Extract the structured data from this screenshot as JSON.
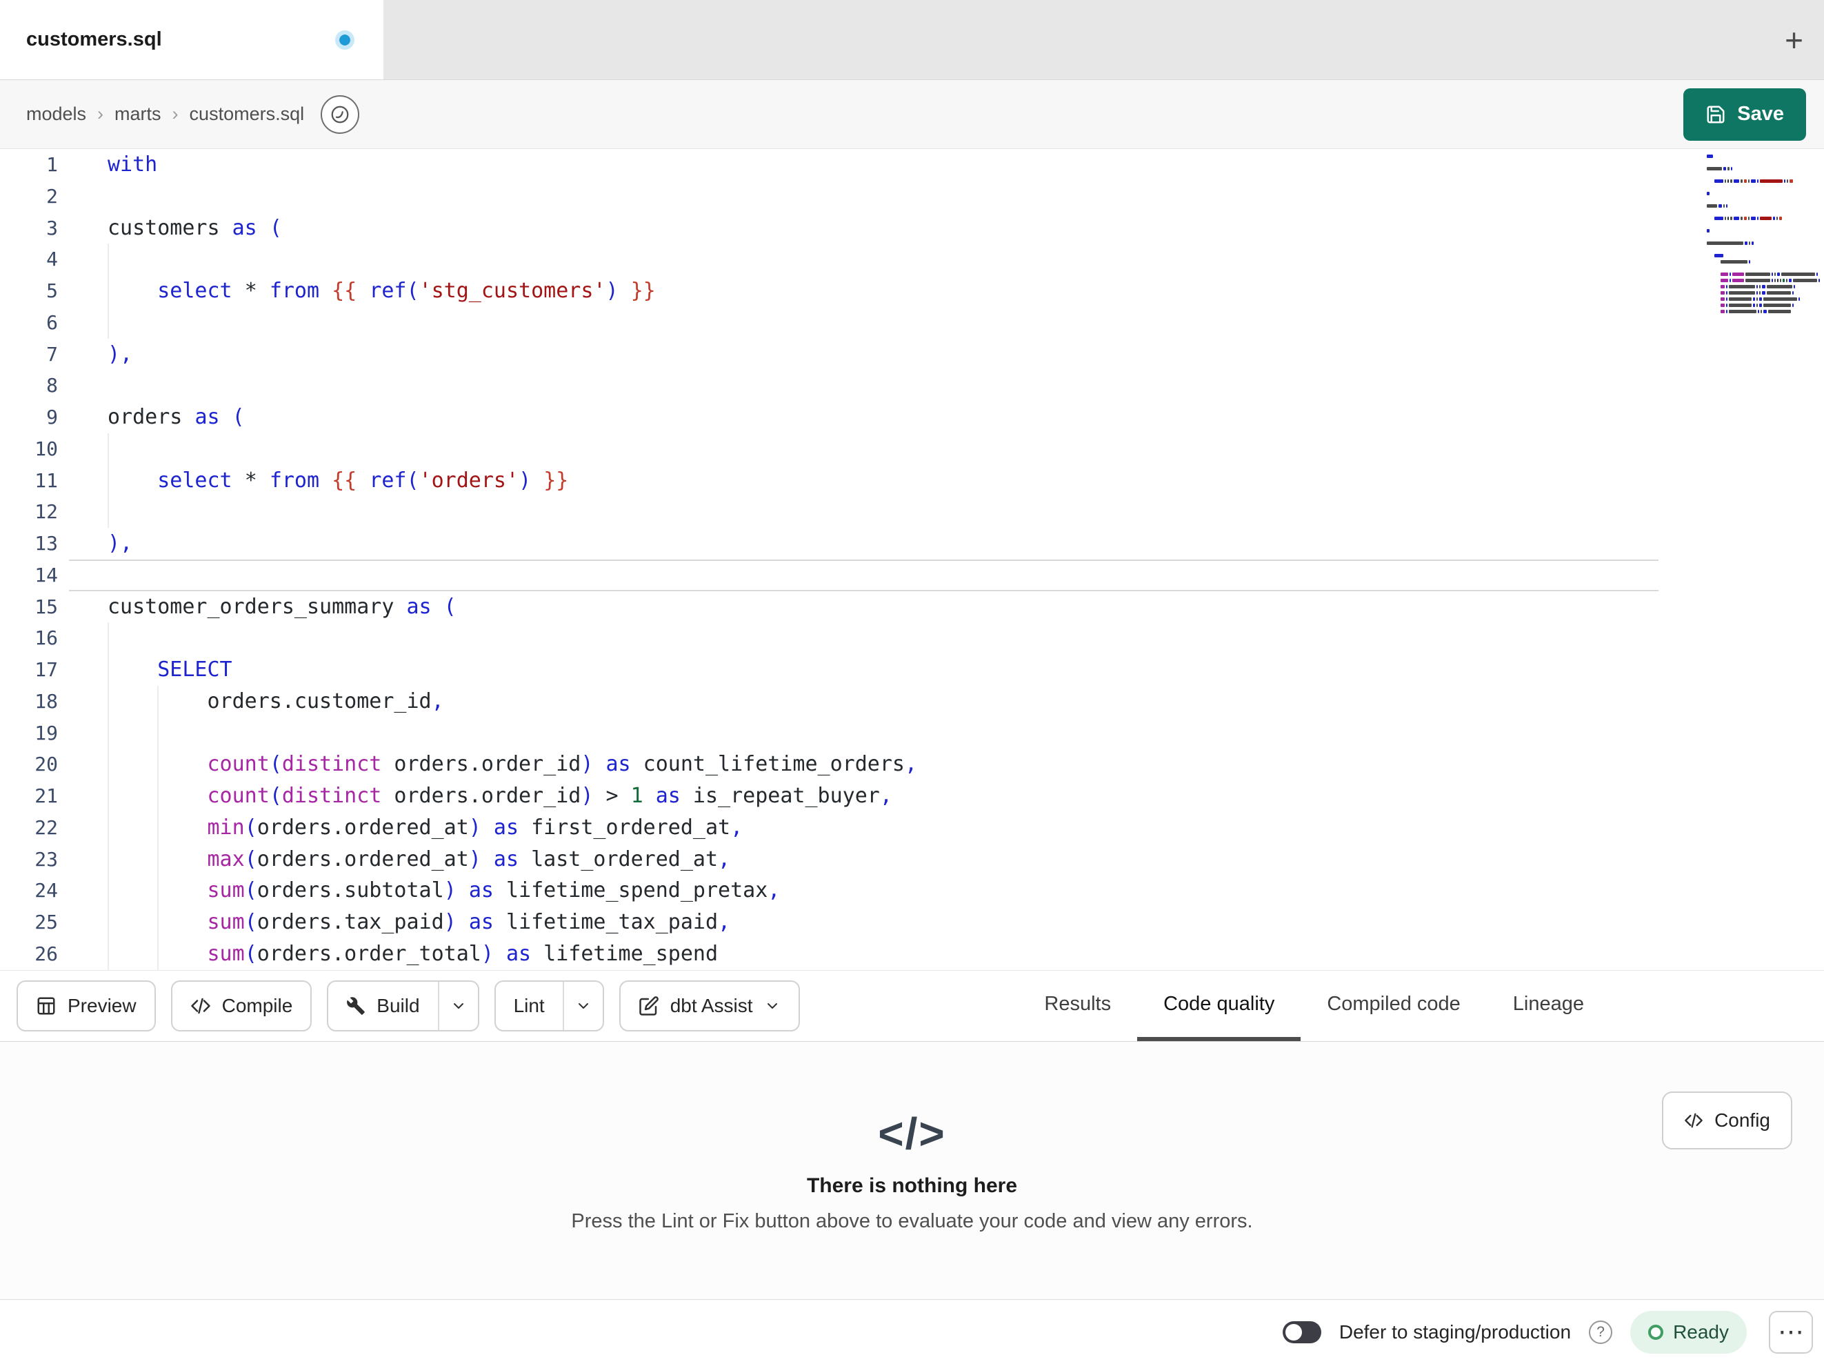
{
  "tab_bar": {
    "tabs": [
      {
        "title": "customers.sql",
        "modified": true
      }
    ],
    "new_tab": "+"
  },
  "breadcrumb": {
    "items": [
      "models",
      "marts",
      "customers.sql"
    ],
    "separator": "›"
  },
  "actions": {
    "save": "Save"
  },
  "editor": {
    "language": "sql",
    "active_line": 14,
    "line_number_color": "#3b4a68",
    "token_colors": {
      "k": "#1d24cf",
      "f": "#a626a4",
      "s": "#a31515",
      "j": "#c23b2b",
      "n": "#0f6b3a",
      "p": "#1d24cf",
      "o": "#24292e",
      "t": "#24292e",
      "w": "#24292e"
    },
    "lines": [
      {
        "t": [
          [
            "k",
            "with"
          ]
        ],
        "g": []
      },
      {
        "t": [],
        "g": []
      },
      {
        "t": [
          [
            "t",
            "customers "
          ],
          [
            "k",
            "as"
          ],
          [
            "t",
            " "
          ],
          [
            "p",
            "("
          ]
        ],
        "g": []
      },
      {
        "t": [],
        "g": [
          0
        ]
      },
      {
        "t": [
          [
            "w",
            "    "
          ],
          [
            "k",
            "select"
          ],
          [
            "t",
            " "
          ],
          [
            "o",
            "*"
          ],
          [
            "t",
            " "
          ],
          [
            "k",
            "from"
          ],
          [
            "t",
            " "
          ],
          [
            "j",
            "{{"
          ],
          [
            "t",
            " "
          ],
          [
            "k",
            "ref"
          ],
          [
            "p",
            "("
          ],
          [
            "s",
            "'stg_customers'"
          ],
          [
            "p",
            ")"
          ],
          [
            "t",
            " "
          ],
          [
            "j",
            "}}"
          ]
        ],
        "g": [
          0
        ]
      },
      {
        "t": [],
        "g": [
          0
        ]
      },
      {
        "t": [
          [
            "p",
            "),"
          ]
        ],
        "g": []
      },
      {
        "t": [],
        "g": []
      },
      {
        "t": [
          [
            "t",
            "orders "
          ],
          [
            "k",
            "as"
          ],
          [
            "t",
            " "
          ],
          [
            "p",
            "("
          ]
        ],
        "g": []
      },
      {
        "t": [],
        "g": [
          0
        ]
      },
      {
        "t": [
          [
            "w",
            "    "
          ],
          [
            "k",
            "select"
          ],
          [
            "t",
            " "
          ],
          [
            "o",
            "*"
          ],
          [
            "t",
            " "
          ],
          [
            "k",
            "from"
          ],
          [
            "t",
            " "
          ],
          [
            "j",
            "{{"
          ],
          [
            "t",
            " "
          ],
          [
            "k",
            "ref"
          ],
          [
            "p",
            "("
          ],
          [
            "s",
            "'orders'"
          ],
          [
            "p",
            ")"
          ],
          [
            "t",
            " "
          ],
          [
            "j",
            "}}"
          ]
        ],
        "g": [
          0
        ]
      },
      {
        "t": [],
        "g": [
          0
        ]
      },
      {
        "t": [
          [
            "p",
            "),"
          ]
        ],
        "g": []
      },
      {
        "t": [],
        "g": []
      },
      {
        "t": [
          [
            "t",
            "customer_orders_summary "
          ],
          [
            "k",
            "as"
          ],
          [
            "t",
            " "
          ],
          [
            "p",
            "("
          ]
        ],
        "g": []
      },
      {
        "t": [],
        "g": [
          0
        ]
      },
      {
        "t": [
          [
            "w",
            "    "
          ],
          [
            "k",
            "SELECT"
          ]
        ],
        "g": [
          0
        ]
      },
      {
        "t": [
          [
            "w",
            "        "
          ],
          [
            "t",
            "orders.customer_id"
          ],
          [
            "p",
            ","
          ]
        ],
        "g": [
          0,
          4
        ]
      },
      {
        "t": [],
        "g": [
          0,
          4
        ]
      },
      {
        "t": [
          [
            "w",
            "        "
          ],
          [
            "f",
            "count"
          ],
          [
            "p",
            "("
          ],
          [
            "f",
            "distinct"
          ],
          [
            "t",
            " orders.order_id"
          ],
          [
            "p",
            ")"
          ],
          [
            "t",
            " "
          ],
          [
            "k",
            "as"
          ],
          [
            "t",
            " count_lifetime_orders"
          ],
          [
            "p",
            ","
          ]
        ],
        "g": [
          0,
          4
        ]
      },
      {
        "t": [
          [
            "w",
            "        "
          ],
          [
            "f",
            "count"
          ],
          [
            "p",
            "("
          ],
          [
            "f",
            "distinct"
          ],
          [
            "t",
            " orders.order_id"
          ],
          [
            "p",
            ")"
          ],
          [
            "t",
            " "
          ],
          [
            "o",
            ">"
          ],
          [
            "t",
            " "
          ],
          [
            "n",
            "1"
          ],
          [
            "t",
            " "
          ],
          [
            "k",
            "as"
          ],
          [
            "t",
            " is_repeat_buyer"
          ],
          [
            "p",
            ","
          ]
        ],
        "g": [
          0,
          4
        ]
      },
      {
        "t": [
          [
            "w",
            "        "
          ],
          [
            "f",
            "min"
          ],
          [
            "p",
            "("
          ],
          [
            "t",
            "orders.ordered_at"
          ],
          [
            "p",
            ")"
          ],
          [
            "t",
            " "
          ],
          [
            "k",
            "as"
          ],
          [
            "t",
            " first_ordered_at"
          ],
          [
            "p",
            ","
          ]
        ],
        "g": [
          0,
          4
        ]
      },
      {
        "t": [
          [
            "w",
            "        "
          ],
          [
            "f",
            "max"
          ],
          [
            "p",
            "("
          ],
          [
            "t",
            "orders.ordered_at"
          ],
          [
            "p",
            ")"
          ],
          [
            "t",
            " "
          ],
          [
            "k",
            "as"
          ],
          [
            "t",
            " last_ordered_at"
          ],
          [
            "p",
            ","
          ]
        ],
        "g": [
          0,
          4
        ]
      },
      {
        "t": [
          [
            "w",
            "        "
          ],
          [
            "f",
            "sum"
          ],
          [
            "p",
            "("
          ],
          [
            "t",
            "orders.subtotal"
          ],
          [
            "p",
            ")"
          ],
          [
            "t",
            " "
          ],
          [
            "k",
            "as"
          ],
          [
            "t",
            " lifetime_spend_pretax"
          ],
          [
            "p",
            ","
          ]
        ],
        "g": [
          0,
          4
        ]
      },
      {
        "t": [
          [
            "w",
            "        "
          ],
          [
            "f",
            "sum"
          ],
          [
            "p",
            "("
          ],
          [
            "t",
            "orders.tax_paid"
          ],
          [
            "p",
            ")"
          ],
          [
            "t",
            " "
          ],
          [
            "k",
            "as"
          ],
          [
            "t",
            " lifetime_tax_paid"
          ],
          [
            "p",
            ","
          ]
        ],
        "g": [
          0,
          4
        ]
      },
      {
        "t": [
          [
            "w",
            "        "
          ],
          [
            "f",
            "sum"
          ],
          [
            "p",
            "("
          ],
          [
            "t",
            "orders.order_total"
          ],
          [
            "p",
            ")"
          ],
          [
            "t",
            " "
          ],
          [
            "k",
            "as"
          ],
          [
            "t",
            " lifetime_spend"
          ]
        ],
        "g": [
          0,
          4
        ]
      }
    ]
  },
  "toolbar": {
    "preview": "Preview",
    "compile": "Compile",
    "build": "Build",
    "lint": "Lint",
    "dbt_assist": "dbt Assist"
  },
  "result_tabs": [
    {
      "label": "Results",
      "active": false
    },
    {
      "label": "Code quality",
      "active": true
    },
    {
      "label": "Compiled code",
      "active": false
    },
    {
      "label": "Lineage",
      "active": false
    }
  ],
  "empty_state": {
    "icon": "</>",
    "title": "There is nothing here",
    "subtitle": "Press the Lint or Fix button above to evaluate your code and view any errors.",
    "config_label": "Config"
  },
  "status_bar": {
    "defer_label": "Defer to staging/production",
    "defer_enabled": false,
    "help": "?",
    "ready_label": "Ready",
    "more": "⋯"
  },
  "colors": {
    "accent_green": "#0e7662",
    "tab_dot": "#1e9ad6",
    "ready_bg": "#e5f4ea",
    "ready_ring": "#3f9e63",
    "active_line_border": "#d9d9d9"
  }
}
